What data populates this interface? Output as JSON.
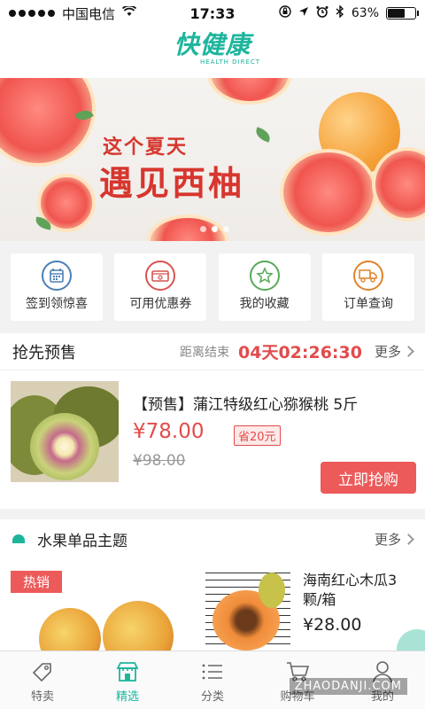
{
  "status_bar": {
    "carrier": "中国电信",
    "time": "17:33",
    "battery": "63%",
    "battery_level": 0.63
  },
  "header": {
    "logo_text": "快健康",
    "logo_sub": "HEALTH DIRECT"
  },
  "banner": {
    "line1": "这个夏天",
    "line2": "遇见西柚",
    "slide_count": 3,
    "active_slide": 2
  },
  "quick_entries": [
    {
      "label": "签到领惊喜",
      "icon": "calendar-icon",
      "color": "#4a7fb5"
    },
    {
      "label": "可用优惠券",
      "icon": "coupon-icon",
      "color": "#d9534f"
    },
    {
      "label": "我的收藏",
      "icon": "star-icon",
      "color": "#5aa85a"
    },
    {
      "label": "订单查询",
      "icon": "truck-icon",
      "color": "#e0832a"
    }
  ],
  "presale": {
    "title": "抢先预售",
    "countdown_label": "距离结束",
    "countdown": "04天02:26:30",
    "more": "更多",
    "product": {
      "name": "【预售】蒲江特级红心猕猴桃 5斤",
      "price": "¥78.00",
      "save": "省20元",
      "original_price": "¥98.00",
      "button": "立即抢购"
    }
  },
  "theme": {
    "title": "水果单品主题",
    "more": "更多",
    "hot_badge": "热销",
    "item": {
      "name": "海南红心木瓜3颗/箱",
      "price": "¥28.00"
    }
  },
  "tabbar": [
    {
      "label": "特卖",
      "icon": "tag-icon",
      "active": false
    },
    {
      "label": "精选",
      "icon": "shop-icon",
      "active": true
    },
    {
      "label": "分类",
      "icon": "list-icon",
      "active": false
    },
    {
      "label": "购物车",
      "icon": "cart-icon",
      "active": false
    },
    {
      "label": "我的",
      "icon": "user-icon",
      "active": false
    }
  ],
  "watermark": "ZHAODANJI.COM",
  "colors": {
    "brand": "#1db59c",
    "accent_red": "#e24b4b"
  }
}
